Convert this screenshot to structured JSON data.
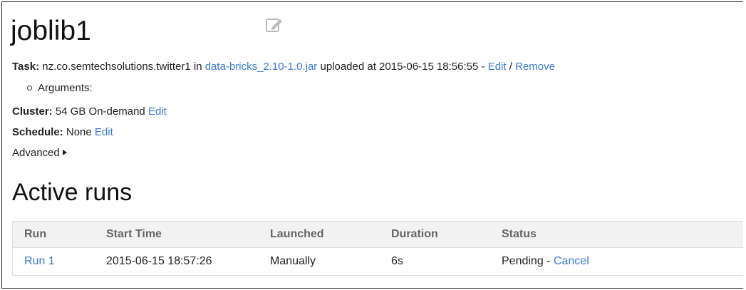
{
  "job": {
    "title": "joblib1",
    "edit_icon": "edit-icon"
  },
  "task": {
    "label": "Task:",
    "class_name": "nz.co.semtechsolutions.twitter1",
    "in_text": "in",
    "jar_link": "data-bricks_2.10-1.0.jar",
    "uploaded_text": "uploaded at 2015-06-15 18:56:55 -",
    "edit_link": "Edit",
    "separator": "/",
    "remove_link": "Remove"
  },
  "arguments": {
    "label": "Arguments:"
  },
  "cluster": {
    "label": "Cluster:",
    "value": "54 GB On-demand",
    "edit_link": "Edit"
  },
  "schedule": {
    "label": "Schedule:",
    "value": "None",
    "edit_link": "Edit"
  },
  "advanced": {
    "label": "Advanced"
  },
  "active_runs": {
    "title": "Active runs",
    "columns": [
      "Run",
      "Start Time",
      "Launched",
      "Duration",
      "Status"
    ],
    "rows": [
      {
        "run": "Run 1",
        "start_time": "2015-06-15 18:57:26",
        "launched": "Manually",
        "duration": "6s",
        "status": "Pending",
        "status_separator": "-",
        "cancel_link": "Cancel"
      }
    ]
  },
  "colors": {
    "link": "#3b7bd1",
    "header_bg": "#f2f2f2",
    "border": "#dddddd"
  }
}
